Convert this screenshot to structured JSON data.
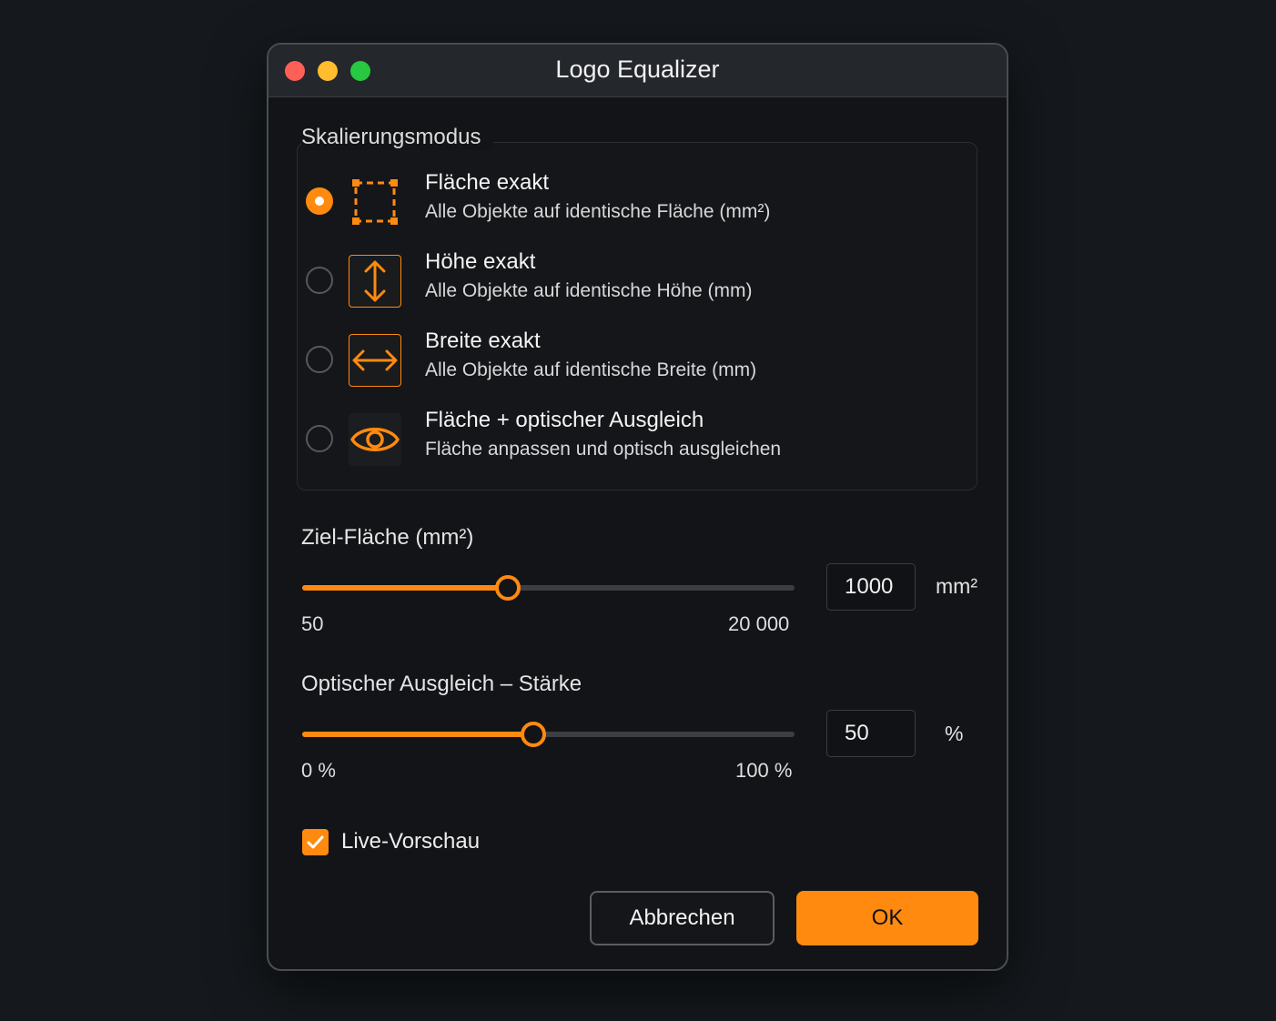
{
  "window": {
    "title": "Logo Equalizer"
  },
  "scaling_mode": {
    "label": "Skalierungsmodus",
    "options": [
      {
        "title": "Fläche exakt",
        "description": "Alle Objekte auf identische Fläche (mm²)",
        "icon": "area-select-icon",
        "selected": true
      },
      {
        "title": "Höhe exakt",
        "description": "Alle Objekte auf identische Höhe (mm)",
        "icon": "vertical-arrows-icon",
        "selected": false
      },
      {
        "title": "Breite exakt",
        "description": "Alle Objekte auf identische Breite (mm)",
        "icon": "horizontal-arrows-icon",
        "selected": false
      },
      {
        "title": "Fläche + optischer Ausgleich",
        "description": "Fläche anpassen und optisch ausgleichen",
        "icon": "eye-icon",
        "selected": false
      }
    ]
  },
  "target_area": {
    "label": "Ziel-Fläche (mm²)",
    "min_label": "50",
    "max_label": "20 000",
    "value": "1000",
    "unit": "mm²",
    "slider_fraction": 0.418
  },
  "optical_strength": {
    "label": "Optischer Ausgleich – Stärke",
    "min_label": "0 %",
    "max_label": "100 %",
    "value": "50",
    "unit": "%",
    "slider_fraction": 0.47
  },
  "live_preview": {
    "label": "Live-Vorschau",
    "checked": true
  },
  "buttons": {
    "cancel": "Abbrechen",
    "ok": "OK"
  },
  "colors": {
    "accent": "#ff8a0f",
    "background": "#121417",
    "titlebar": "#24272b"
  }
}
